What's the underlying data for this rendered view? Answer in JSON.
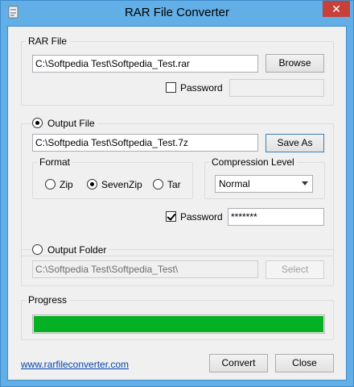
{
  "window": {
    "title": "RAR File Converter",
    "close_glyph": "✕"
  },
  "rar_file": {
    "group_label": "RAR File",
    "path_value": "C:\\Softpedia Test\\Softpedia_Test.rar",
    "browse_label": "Browse",
    "password_label": "Password",
    "password_checked": false,
    "password_value": ""
  },
  "output_file": {
    "radio_label": "Output File",
    "selected": true,
    "path_value": "C:\\Softpedia Test\\Softpedia_Test.7z",
    "save_as_label": "Save As",
    "format": {
      "group_label": "Format",
      "options": [
        "Zip",
        "SevenZip",
        "Tar"
      ],
      "selected": "SevenZip"
    },
    "compression": {
      "group_label": "Compression Level",
      "selected": "Normal"
    },
    "password_label": "Password",
    "password_checked": true,
    "password_value": "*******"
  },
  "output_folder": {
    "radio_label": "Output Folder",
    "selected": false,
    "path_value": "C:\\Softpedia Test\\Softpedia_Test\\",
    "select_label": "Select"
  },
  "progress": {
    "group_label": "Progress",
    "fraction": 1.0,
    "bar_color": "#06b025"
  },
  "footer": {
    "link_text": "www.rarfileconverter.com",
    "convert_label": "Convert",
    "close_label": "Close"
  }
}
